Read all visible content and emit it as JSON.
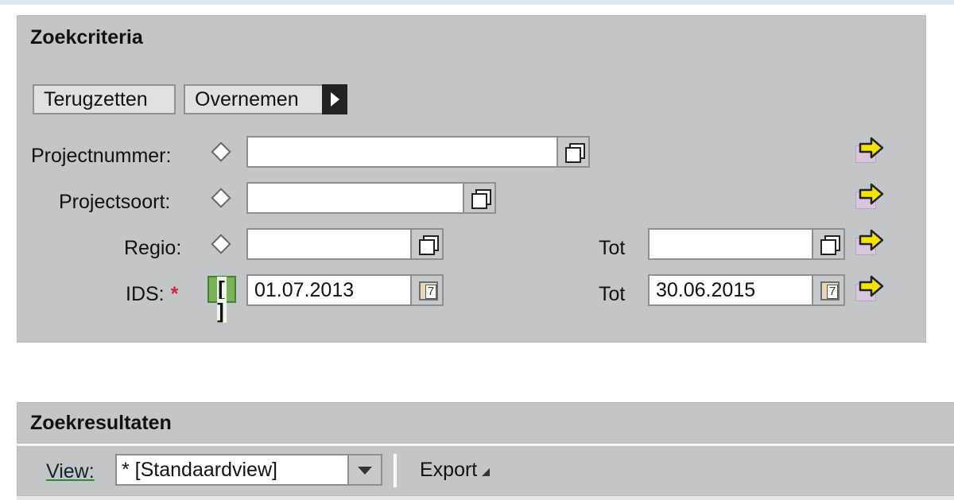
{
  "criteria": {
    "title": "Zoekcriteria",
    "buttons": {
      "reset": "Terugzetten",
      "apply": "Overnemen"
    },
    "fields": [
      {
        "label": "Projectnummer:",
        "value": "",
        "op_icon": "diamond-icon"
      },
      {
        "label": "Projectsoort:",
        "value": "",
        "op_icon": "diamond-icon"
      },
      {
        "label": "Regio:",
        "value": "",
        "op_icon": "diamond-icon",
        "to_label": "Tot",
        "to_value": ""
      },
      {
        "label": "IDS:",
        "required_marker": "*",
        "value": "01.07.2013",
        "op_icon": "between-bracket-icon",
        "op_text": "[ ]",
        "to_label": "Tot",
        "to_value": "30.06.2015"
      }
    ]
  },
  "results": {
    "title": "Zoekresultaten",
    "view_label": "View:",
    "view_value": "* [Standaardview]",
    "export_label": "Export"
  },
  "colors": {
    "panel": "#c3c6c9",
    "required": "#d6253a",
    "multi_arrow": "#f5e400",
    "between_icon": "#7ab35c"
  }
}
